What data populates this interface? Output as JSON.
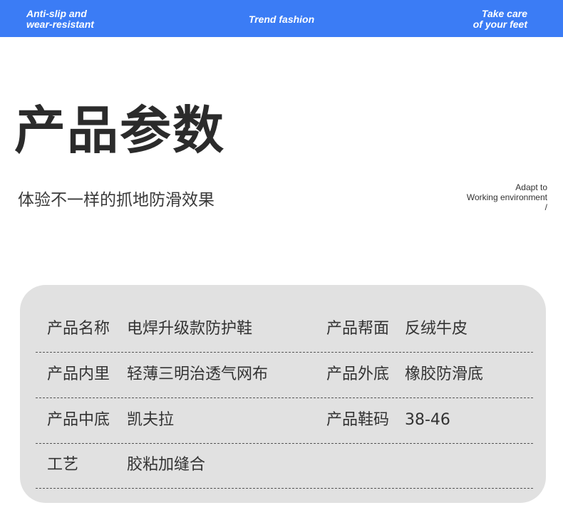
{
  "topbar": {
    "left_line1": "Anti-slip and",
    "left_line2": "wear-resistant",
    "center": "Trend fashion",
    "right_line1": "Take care",
    "right_line2": "of your feet"
  },
  "title": "产品参数",
  "subtitle": "体验不一样的抓地防滑效果",
  "side_note": {
    "line1": "Adapt to",
    "line2": "Working environment",
    "line3": "/"
  },
  "specs": [
    {
      "label1": "产品名称",
      "value1": "电焊升级款防护鞋",
      "label2": "产品帮面",
      "value2": "反绒牛皮"
    },
    {
      "label1": "产品内里",
      "value1": "轻薄三明治透气网布",
      "label2": "产品外底",
      "value2": "橡胶防滑底"
    },
    {
      "label1": "产品中底",
      "value1": "凯夫拉",
      "label2": "产品鞋码",
      "value2": "38-46"
    },
    {
      "label1": "工艺",
      "value1": "胶粘加缝合",
      "label2": "",
      "value2": ""
    }
  ],
  "colors": {
    "topbar": "#3b7cf5",
    "card": "#e1e1e1",
    "text": "#333333"
  }
}
